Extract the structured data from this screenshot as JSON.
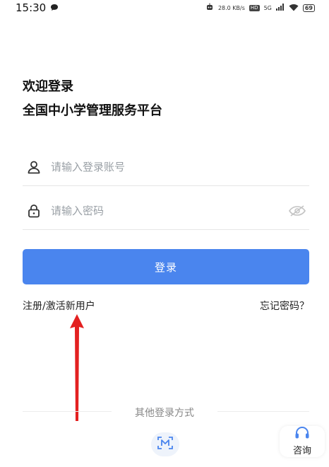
{
  "status_bar": {
    "time": "15:30",
    "speed": "28.0 KB/s",
    "hd_badge": "HD",
    "network": "5G",
    "battery": "69"
  },
  "header": {
    "welcome": "欢迎登录",
    "platform": "全国中小学管理服务平台"
  },
  "form": {
    "account_placeholder": "请输入登录账号",
    "password_placeholder": "请输入密码",
    "login_label": "登录"
  },
  "links": {
    "register": "注册/激活新用户",
    "forgot": "忘记密码？"
  },
  "footer": {
    "other_login": "其他登录方式",
    "consult": "咨询"
  },
  "colors": {
    "primary": "#4a85ee",
    "annotation_arrow": "#e32020"
  }
}
